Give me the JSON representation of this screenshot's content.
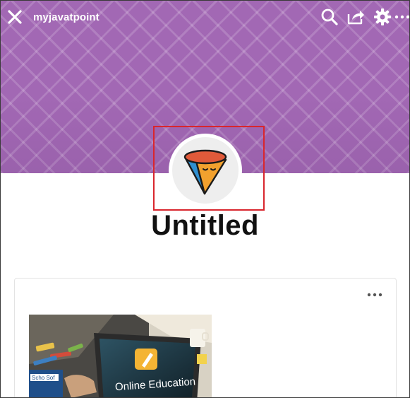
{
  "header": {
    "site_name": "myjavatpoint",
    "icons": [
      "close-icon",
      "search-icon",
      "share-icon",
      "gear-icon",
      "more-icon"
    ],
    "banner_color": "#a268b4"
  },
  "profile": {
    "title": "Untitled",
    "logo_icon": "cone-logo-icon",
    "highlight_color": "#d9262d"
  },
  "card": {
    "more_icon": "more-horizontal-icon",
    "image": {
      "caption": "Online Education",
      "laptop_text": "Scho Sof"
    }
  }
}
